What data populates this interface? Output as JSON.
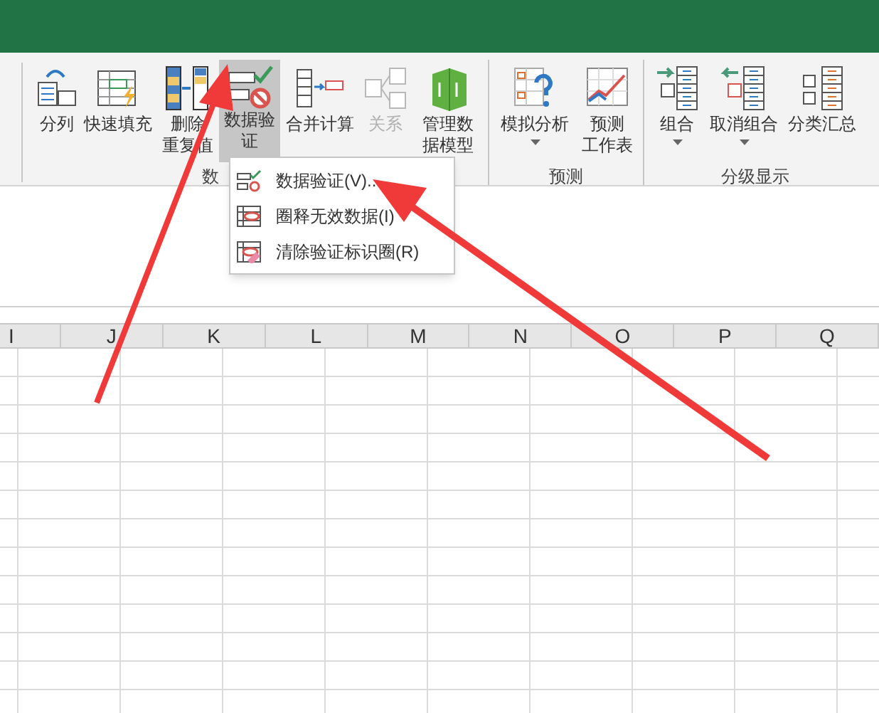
{
  "ribbon": {
    "groups": [
      {
        "label": "数",
        "buttons": [
          {
            "label": "分列",
            "dropdown": false,
            "selected": false,
            "disabled": false
          },
          {
            "label": "快速填充",
            "dropdown": false,
            "selected": false,
            "disabled": false
          },
          {
            "label": "删除重复值",
            "dropdown": false,
            "selected": false,
            "disabled": false
          },
          {
            "label": "数据验证",
            "dropdown": true,
            "selected": true,
            "disabled": false
          },
          {
            "label": "合并计算",
            "dropdown": false,
            "selected": false,
            "disabled": false
          },
          {
            "label": "关系",
            "dropdown": false,
            "selected": false,
            "disabled": true
          },
          {
            "label": "管理数据模型",
            "dropdown": false,
            "selected": false,
            "disabled": false
          }
        ]
      },
      {
        "label": "预测",
        "buttons": [
          {
            "label": "模拟分析",
            "dropdown": true,
            "selected": false,
            "disabled": false
          },
          {
            "label": "预测工作表",
            "dropdown": false,
            "selected": false,
            "disabled": false
          }
        ]
      },
      {
        "label": "分级显示",
        "buttons": [
          {
            "label": "组合",
            "dropdown": true,
            "selected": false,
            "disabled": false
          },
          {
            "label": "取消组合",
            "dropdown": true,
            "selected": false,
            "disabled": false
          },
          {
            "label": "分类汇总",
            "dropdown": false,
            "selected": false,
            "disabled": false
          }
        ]
      }
    ]
  },
  "menu": {
    "items": [
      {
        "label": "数据验证(V)..."
      },
      {
        "label": "圈释无效数据(I)"
      },
      {
        "label": "清除验证标识圈(R)"
      }
    ]
  },
  "columns": [
    "I",
    "J",
    "K",
    "L",
    "M",
    "N",
    "O",
    "P",
    "Q"
  ]
}
